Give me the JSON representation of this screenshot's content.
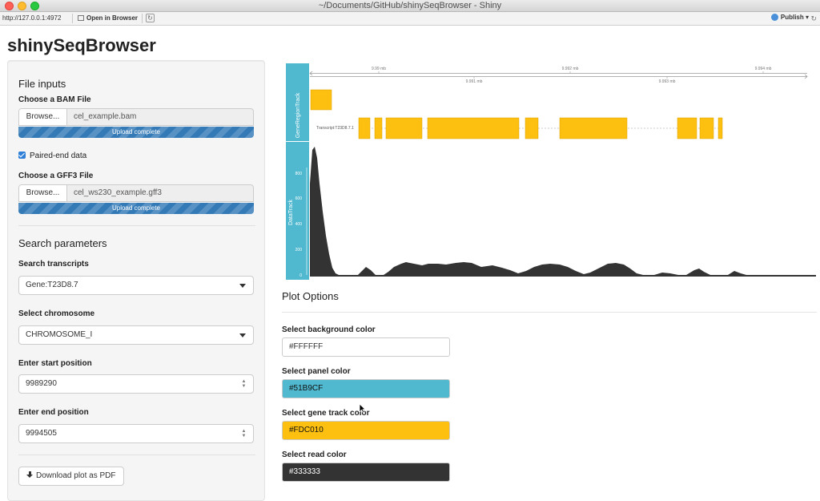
{
  "window": {
    "title": "~/Documents/GitHub/shinySeqBrowser - Shiny"
  },
  "toolbar": {
    "url": "http://127.0.0.1:4972",
    "open_in_browser": "Open in Browser",
    "publish": "Publish"
  },
  "app": {
    "title": "shinySeqBrowser"
  },
  "sidebar": {
    "file_inputs_heading": "File inputs",
    "bam_label": "Choose a BAM File",
    "bam_browse": "Browse...",
    "bam_filename": "cel_example.bam",
    "bam_status": "Upload complete",
    "bam_progress": 1.0,
    "paired_end_label": "Paired-end data",
    "paired_end_checked": true,
    "gff_label": "Choose a GFF3 File",
    "gff_browse": "Browse...",
    "gff_filename": "cel_ws230_example.gff3",
    "gff_status": "Upload complete",
    "gff_progress": 1.0,
    "search_heading": "Search parameters",
    "transcript_label": "Search transcripts",
    "transcript_value": "Gene:T23D8.7",
    "chromosome_label": "Select chromosome",
    "chromosome_value": "CHROMOSOME_I",
    "start_label": "Enter start position",
    "start_value": "9989290",
    "end_label": "Enter end position",
    "end_value": "9994505",
    "download_label": "Download plot as PDF"
  },
  "plot": {
    "axis_ticks_top": [
      "9.99 mb",
      "9.992 mb",
      "9.994 mb"
    ],
    "axis_ticks_bottom": [
      "9.991 mb",
      "9.993 mb"
    ],
    "gene_track_label": "GeneRegionTrack",
    "transcript_label": "Transcript:T23D8.7.1",
    "data_track_label": "DataTrack",
    "y_ticks": [
      "800",
      "600",
      "400",
      "200",
      "0"
    ]
  },
  "plot_options": {
    "heading": "Plot Options",
    "bg_label": "Select background color",
    "bg_value": "#FFFFFF",
    "panel_label": "Select panel color",
    "panel_value": "#51B9CF",
    "gene_label": "Select gene track color",
    "gene_value": "#FDC010",
    "read_label": "Select read color",
    "read_value": "#333333"
  },
  "colors": {
    "panel": "#51B9CF",
    "gene": "#FDC010",
    "read": "#333333",
    "progress": "#337AB7"
  },
  "icons": {
    "open_in_browser": "browser-icon",
    "refresh": "refresh-icon",
    "publish": "publish-icon",
    "download": "download-icon",
    "checkbox": "checkbox-icon"
  }
}
